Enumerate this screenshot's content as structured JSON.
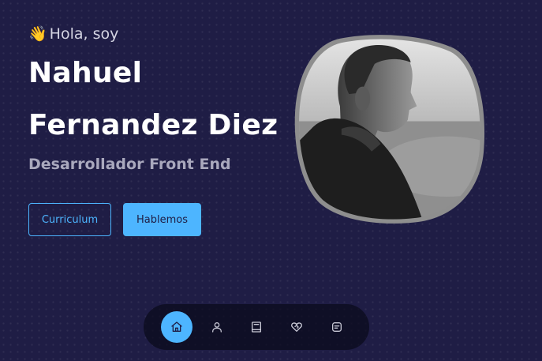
{
  "hero": {
    "greeting_icon": "waving-hand-icon",
    "greeting": "Hola, soy",
    "name_first": "Nahuel",
    "name_last": "Fernandez Diez",
    "role": "Desarrollador Front End",
    "cv_button": "Curriculum",
    "contact_button": "Hablemos"
  },
  "portrait": {
    "icon": "profile-photo"
  },
  "nav": {
    "items": [
      {
        "icon": "home-icon",
        "active": true
      },
      {
        "icon": "user-icon",
        "active": false
      },
      {
        "icon": "book-icon",
        "active": false
      },
      {
        "icon": "heart-handshake-icon",
        "active": false
      },
      {
        "icon": "message-icon",
        "active": false
      }
    ]
  },
  "colors": {
    "background": "#1f1d45",
    "accent": "#4db5ff",
    "title": "#ffffff",
    "muted": "#a9a8bd",
    "nav_bg": "#0a0a1a"
  }
}
